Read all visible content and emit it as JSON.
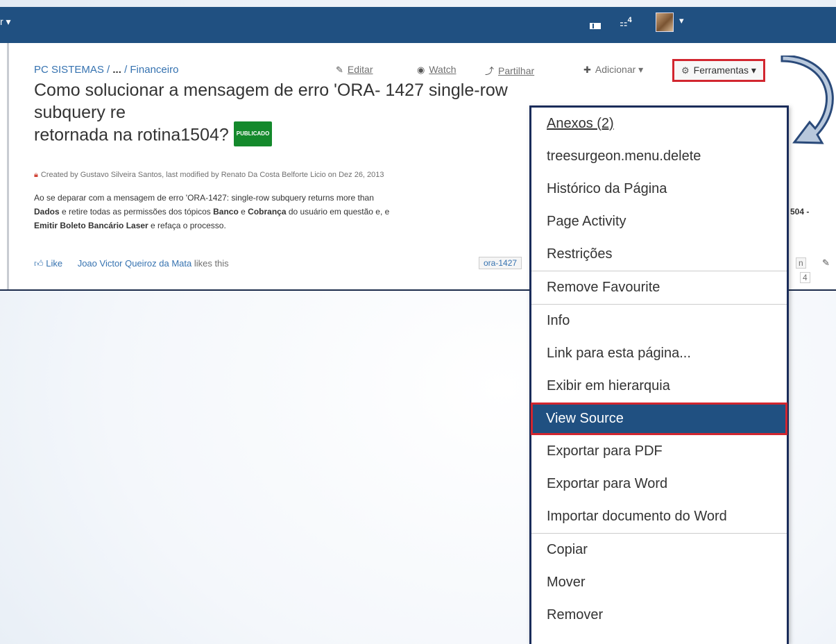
{
  "topbar": {
    "left_caret": "r ▾",
    "sidebar_icon": "sidebar-toggle-icon",
    "notifications_icon": "notifications-icon",
    "notifications_count": "4",
    "avatar_caret": "▾"
  },
  "breadcrumb": {
    "space": "PC SISTEMAS /",
    "ellipsis": "...",
    "page": "/ Financeiro"
  },
  "page": {
    "title": "Como solucionar a mensagem de erro 'ORA- 1427 single-row subquery re",
    "title_line3": "retornada na rotina1504?",
    "status_badge": "PUBLICADO",
    "meta": "Created by Gustavo Silveira Santos, last modified by Renato Da Costa Belforte Licio on Dez 26, 2013",
    "body_line1": "Ao se deparar com a mensagem de erro 'ORA-1427: single-row subquery returns more than",
    "body_line2_a": "Dados",
    "body_line2_b": " e retire todas as permissões dos tópicos ",
    "body_line2_c": "Banco",
    "body_line2_d": " e ",
    "body_line2_e": "Cobrança",
    "body_line2_f": " do usuário em questão e, e",
    "body_line2_right": "504 -",
    "body_line3_a": "Emitir Boleto Bancário Laser",
    "body_line3_b": " e refaça o processo.",
    "like": "Like",
    "liker": "Joao Victor Queiroz da Mata",
    "likes_this": " likes this",
    "label": "ora-1427",
    "tag_right": "n",
    "tag_right2": "4"
  },
  "toolbar": {
    "editar": "Editar",
    "watch": "Watch",
    "partilhar": "Partilhar",
    "adicionar": "Adicionar",
    "ferramentas": "Ferramentas"
  },
  "menu": {
    "items": [
      "Anexos (2)",
      "treesurgeon.menu.delete",
      "Histórico da Página",
      "Page Activity",
      "Restrições",
      "Remove Favourite",
      "Info",
      "Link para esta página...",
      "Exibir em hierarquia",
      "View Source",
      "Exportar para PDF",
      "Exportar para Word",
      "Importar documento do Word",
      "Copiar",
      "Mover",
      "Remover"
    ],
    "selected": "View Source"
  },
  "colors": {
    "header_blue": "#205081",
    "link_blue": "#3572b0",
    "highlight_red": "#d2262f",
    "badge_green": "#14892c"
  }
}
